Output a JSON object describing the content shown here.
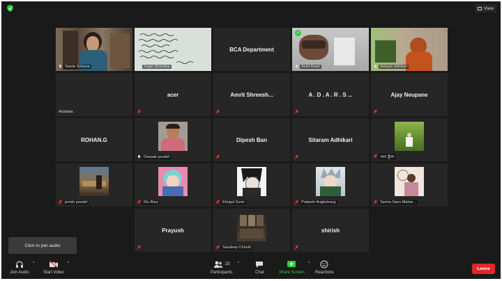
{
  "top": {
    "view_label": "View"
  },
  "colors": {
    "background": "#1a1a1a",
    "tile": "#262626",
    "accent_green": "#2ecc40",
    "leave_red": "#e02828",
    "muted_red": "#e03030"
  },
  "tiles": [
    {
      "name": "Sweta Sohana",
      "type": "video",
      "muted": false
    },
    {
      "name": "Sujan Shrestha",
      "type": "video",
      "muted": false
    },
    {
      "name": "",
      "center": "BCA Department",
      "type": "text",
      "muted": false
    },
    {
      "name": "Ankit khatri",
      "type": "video",
      "muted": false,
      "active": true
    },
    {
      "name": "Aakash Adhikari",
      "type": "video",
      "muted": false
    },
    {
      "name": "Archana",
      "type": "blank",
      "muted": false
    },
    {
      "name": "",
      "center": "acer",
      "type": "text",
      "muted": true
    },
    {
      "name": "",
      "center": "Amrit  Shreesh...",
      "type": "text",
      "muted": true
    },
    {
      "name": "",
      "center": "A . D . A . R . S ...",
      "type": "text",
      "muted": true
    },
    {
      "name": "",
      "center": "Ajay Neupane",
      "type": "text",
      "muted": true
    },
    {
      "name": "",
      "center": "ROHAN.G",
      "type": "text",
      "muted": false
    },
    {
      "name": "Deepak poudel",
      "type": "avatar",
      "muted": false
    },
    {
      "name": "",
      "center": "Dipesh Ban",
      "type": "text",
      "muted": true
    },
    {
      "name": "",
      "center": "Sitaram Adhikari",
      "type": "text",
      "muted": true
    },
    {
      "name": "भरत कुँवर",
      "type": "avatar",
      "muted": true
    },
    {
      "name": "jenish poudel",
      "type": "avatar",
      "muted": true
    },
    {
      "name": "Riu Bisa",
      "type": "avatar",
      "muted": true
    },
    {
      "name": "Ebrigel Gzmr",
      "type": "avatar",
      "muted": true
    },
    {
      "name": "Prakash Angbuhang",
      "type": "avatar",
      "muted": true
    },
    {
      "name": "Sarina Sanu Mahar...",
      "type": "avatar",
      "muted": true
    },
    {
      "name": "",
      "center": "Prayush",
      "type": "text",
      "muted": true
    },
    {
      "name": "Sandeep Chhetri",
      "type": "avatar",
      "muted": true
    },
    {
      "name": "",
      "center": "shirish",
      "type": "text",
      "muted": true
    }
  ],
  "toast": {
    "text": "Click to join audio"
  },
  "toolbar": {
    "join_audio": "Join Audio",
    "start_video": "Start Video",
    "participants": "Participants",
    "participants_count": "23",
    "chat": "Chat",
    "share_screen": "Share Screen",
    "reactions": "Reactions",
    "leave": "Leave"
  }
}
